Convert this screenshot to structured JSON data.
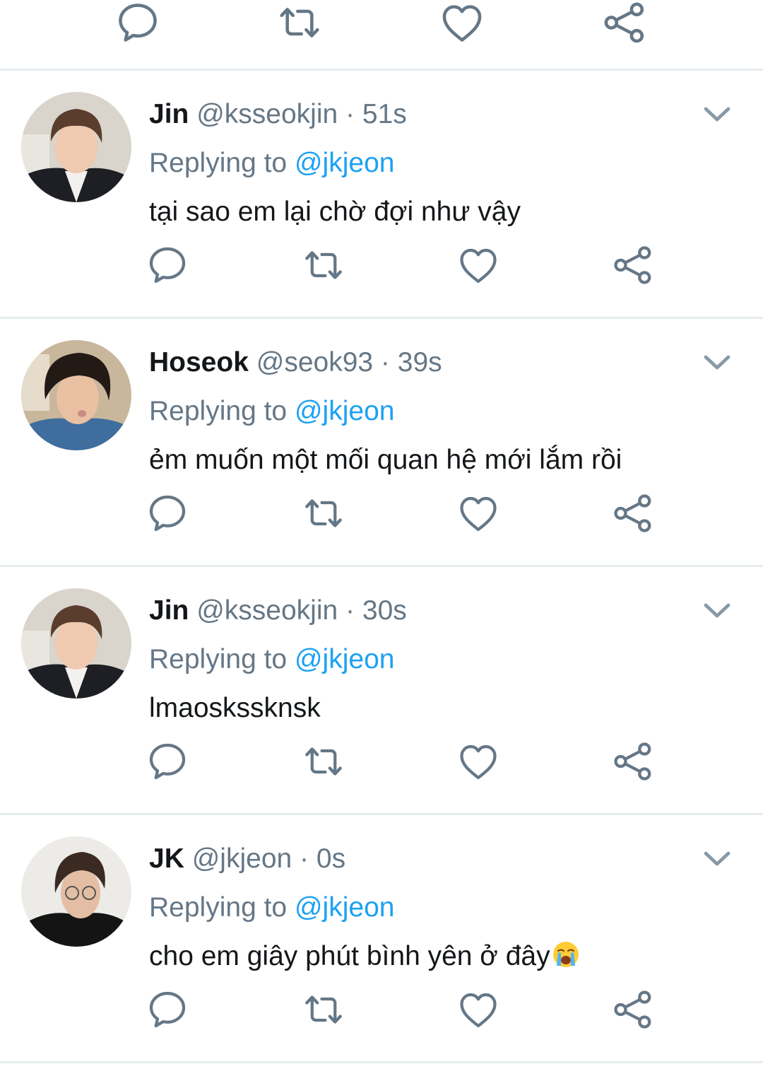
{
  "icons": {
    "reply": "reply-icon",
    "retweet": "retweet-icon",
    "like": "heart-icon",
    "share": "share-icon",
    "more": "chevron-down-icon"
  },
  "colors": {
    "name": "#14171a",
    "secondary": "#657786",
    "link": "#1da1f2",
    "icon": "#657786",
    "divider": "#e6ecf0"
  },
  "tweets": [
    {
      "name": "Jin",
      "handle": "@ksseokjin",
      "sep": " · ",
      "time": "51s",
      "replying_label": "Replying to ",
      "replying_handle": "@jkjeon",
      "text": "tại sao em lại chờ đợi như vậy"
    },
    {
      "name": "Hoseok",
      "handle": "@seok93",
      "sep": " · ",
      "time": "39s",
      "replying_label": "Replying to ",
      "replying_handle": "@jkjeon",
      "text": "ẻm muốn một mối quan hệ mới lắm rồi"
    },
    {
      "name": "Jin",
      "handle": "@ksseokjin",
      "sep": " · ",
      "time": "30s",
      "replying_label": "Replying to ",
      "replying_handle": "@jkjeon",
      "text": "lmaosksskns​k"
    },
    {
      "name": "JK",
      "handle": "@jkjeon",
      "sep": " · ",
      "time": "0s",
      "replying_label": "Replying to ",
      "replying_handle": "@jkjeon",
      "text": "cho em giây phút bình yên ở đây",
      "emoji": "loudly-crying-face-emoji"
    }
  ]
}
